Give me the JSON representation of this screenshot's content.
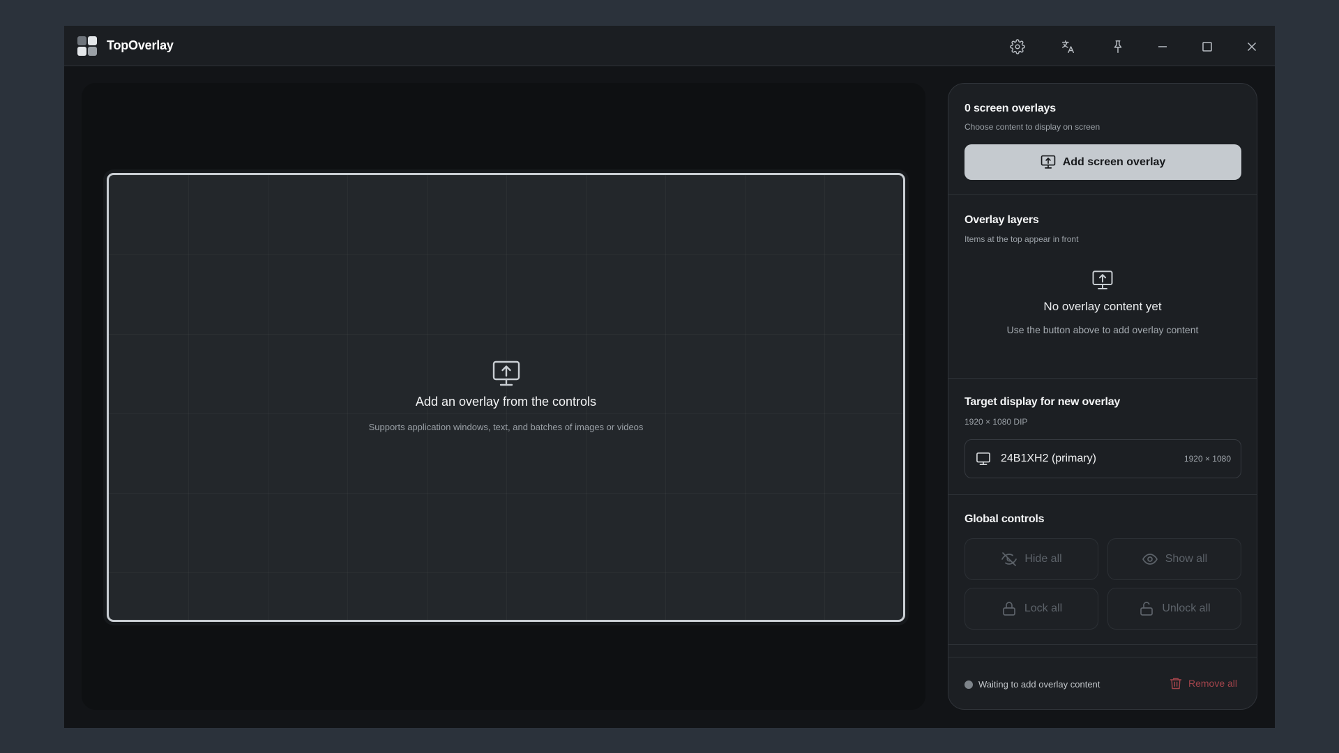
{
  "app": {
    "title": "TopOverlay"
  },
  "titlebar": {
    "icons": [
      "gear-icon",
      "translate-icon",
      "pin-icon",
      "minimize-icon",
      "maximize-icon",
      "close-icon"
    ]
  },
  "canvas": {
    "empty_title": "Add an overlay from the controls",
    "empty_subtitle": "Supports application windows, text, and batches of images or videos"
  },
  "panel": {
    "screen_overlays": {
      "title": "0 screen overlays",
      "subtitle": "Choose content to display on screen",
      "add_button": "Add screen overlay"
    },
    "layers": {
      "title": "Overlay layers",
      "subtitle": "Items at the top appear in front",
      "empty_title": "No overlay content yet",
      "empty_subtitle": "Use the button above to add overlay content"
    },
    "target_display": {
      "title": "Target display for new overlay",
      "subtitle": "1920 × 1080 DIP",
      "display_name": "24B1XH2 (primary)",
      "display_resolution": "1920 × 1080"
    },
    "global_controls": {
      "title": "Global controls",
      "hide_all": "Hide all",
      "show_all": "Show all",
      "lock_all": "Lock all",
      "unlock_all": "Unlock all"
    },
    "footer": {
      "status": "Waiting to add overlay content",
      "remove_all": "Remove all"
    }
  },
  "colors": {
    "desktop": "#2b323b",
    "window": "#121417",
    "panel": "#1c1f23",
    "primary_button": "#c5cacf",
    "danger": "#a2444b"
  }
}
